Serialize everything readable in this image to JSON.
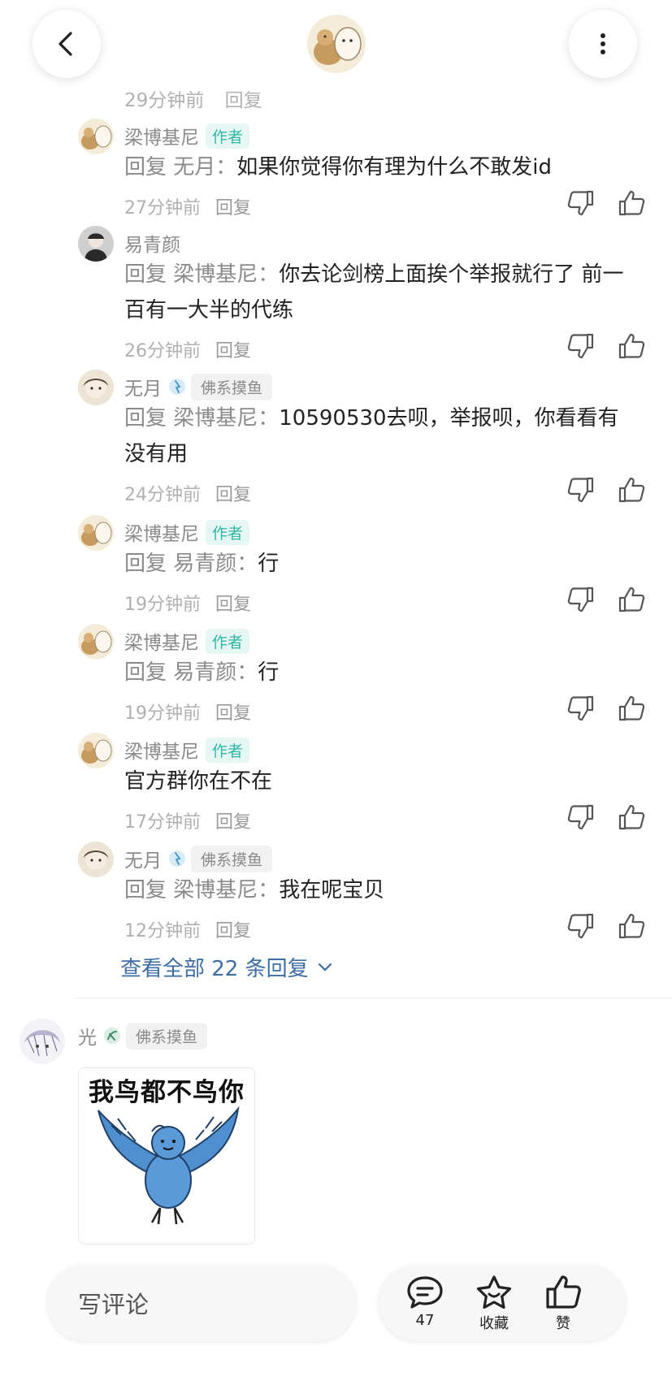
{
  "topbar": {
    "back_icon": "chevron-left-icon",
    "more_icon": "more-vertical-icon",
    "avatar_desc": "author-avatar"
  },
  "cutoff_reply": {
    "time": "29分钟前",
    "reply": "回复"
  },
  "replies": [
    {
      "name": "梁博基尼",
      "author_tag": "作者",
      "reply_to": "回复 无月：",
      "text": "如果你觉得你有理为什么不敢发id",
      "time": "27分钟前",
      "reply": "回复"
    },
    {
      "name": "易青颜",
      "reply_to": "回复 梁博基尼：",
      "text": "你去论剑榜上面挨个举报就行了 前一百有一大半的代练",
      "time": "26分钟前",
      "reply": "回复"
    },
    {
      "name": "无月",
      "badge": "佛系摸鱼",
      "reply_to": "回复 梁博基尼：",
      "text": "10590530去呗，举报呗，你看看有没有用",
      "time": "24分钟前",
      "reply": "回复"
    },
    {
      "name": "梁博基尼",
      "author_tag": "作者",
      "reply_to": "回复 易青颜：",
      "text": "行",
      "time": "19分钟前",
      "reply": "回复"
    },
    {
      "name": "梁博基尼",
      "author_tag": "作者",
      "reply_to": "回复 易青颜：",
      "text": "行",
      "time": "19分钟前",
      "reply": "回复"
    },
    {
      "name": "梁博基尼",
      "author_tag": "作者",
      "reply_to": "",
      "text": "官方群你在不在",
      "time": "17分钟前",
      "reply": "回复"
    },
    {
      "name": "无月",
      "badge": "佛系摸鱼",
      "reply_to": "回复 梁博基尼：",
      "text": "我在呢宝贝",
      "time": "12分钟前",
      "reply": "回复"
    }
  ],
  "view_all": "查看全部 22 条回复",
  "comment2": {
    "name": "光",
    "badge": "佛系摸鱼",
    "sticker_text": "我鸟都不鸟你"
  },
  "bottombar": {
    "write_placeholder": "写评论",
    "comment_count": "47",
    "favorite_label": "收藏",
    "like_label": "赞"
  },
  "colors": {
    "author_tag": "#2fb8a8",
    "link": "#3d6ea3",
    "muted": "#8a8a8a"
  }
}
